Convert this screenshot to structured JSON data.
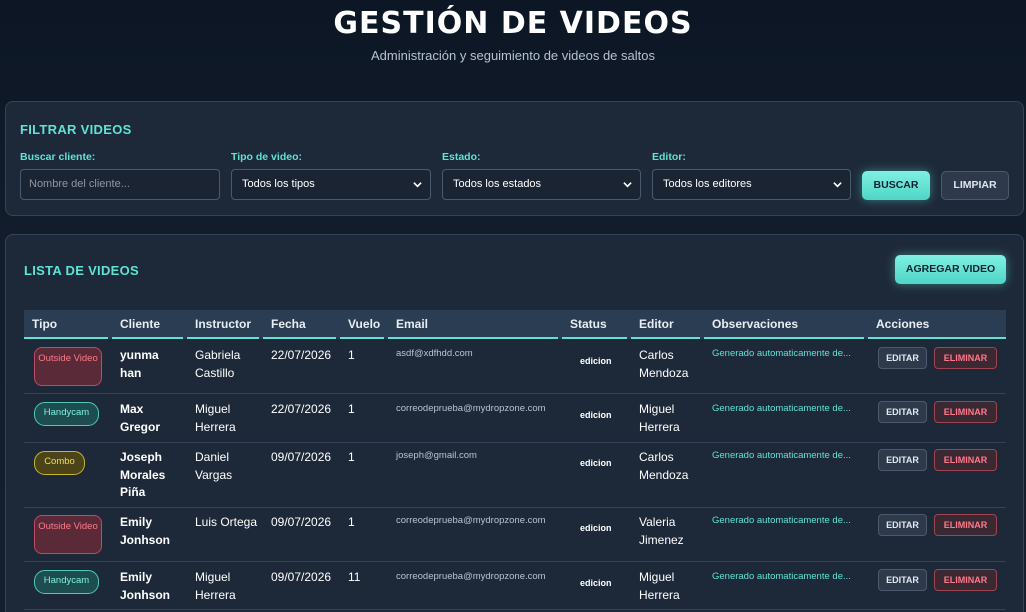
{
  "header": {
    "title": "GESTIÓN DE VIDEOS",
    "subtitle": "Administración y seguimiento de videos de saltos"
  },
  "filters": {
    "title": "FILTRAR VIDEOS",
    "client_label": "Buscar cliente:",
    "client_placeholder": "Nombre del cliente...",
    "type_label": "Tipo de video:",
    "type_value": "Todos los tipos",
    "status_label": "Estado:",
    "status_value": "Todos los estados",
    "editor_label": "Editor:",
    "editor_value": "Todos los editores",
    "search_button": "BUSCAR",
    "clear_button": "LIMPIAR"
  },
  "list": {
    "title": "LISTA DE VIDEOS",
    "add_button": "AGREGAR VIDEO",
    "columns": [
      "Tipo",
      "Cliente",
      "Instructor",
      "Fecha",
      "Vuelo",
      "Email",
      "Status",
      "Editor",
      "Observaciones",
      "Acciones"
    ],
    "edit_label": "EDITAR",
    "delete_label": "ELIMINAR",
    "rows": [
      {
        "type": "Outside Video",
        "type_kind": "outside",
        "client": "yunma han",
        "instructor": "Gabriela Castillo",
        "date": "22/07/2026",
        "flight": "1",
        "email": "asdf@xdfhdd.com",
        "status": "edicion",
        "editor": "Carlos Mendoza",
        "obs": "Generado automaticamente de..."
      },
      {
        "type": "Handycam",
        "type_kind": "handycam",
        "client": "Max Gregor",
        "instructor": "Miguel Herrera",
        "date": "22/07/2026",
        "flight": "1",
        "email": "correodeprueba@mydropzone.com",
        "status": "edicion",
        "editor": "Miguel Herrera",
        "obs": "Generado automaticamente de..."
      },
      {
        "type": "Combo",
        "type_kind": "combo",
        "client": "Joseph Morales Piña",
        "instructor": "Daniel Vargas",
        "date": "09/07/2026",
        "flight": "1",
        "email": "joseph@gmail.com",
        "status": "edicion",
        "editor": "Carlos Mendoza",
        "obs": "Generado automaticamente de..."
      },
      {
        "type": "Outside Video",
        "type_kind": "outside",
        "client": "Emily Jonhson",
        "instructor": "Luis Ortega",
        "date": "09/07/2026",
        "flight": "1",
        "email": "correodeprueba@mydropzone.com",
        "status": "edicion",
        "editor": "Valeria Jimenez",
        "obs": "Generado automaticamente de..."
      },
      {
        "type": "Handycam",
        "type_kind": "handycam",
        "client": "Emily Jonhson",
        "instructor": "Miguel Herrera",
        "date": "09/07/2026",
        "flight": "11",
        "email": "correodeprueba@mydropzone.com",
        "status": "edicion",
        "editor": "Miguel Herrera",
        "obs": "Generado automaticamente de..."
      }
    ]
  },
  "colors": {
    "accent": "#5ee3d4",
    "danger": "#ff7a8a",
    "combo": "#f1dd58",
    "panel": "#1d2939"
  }
}
